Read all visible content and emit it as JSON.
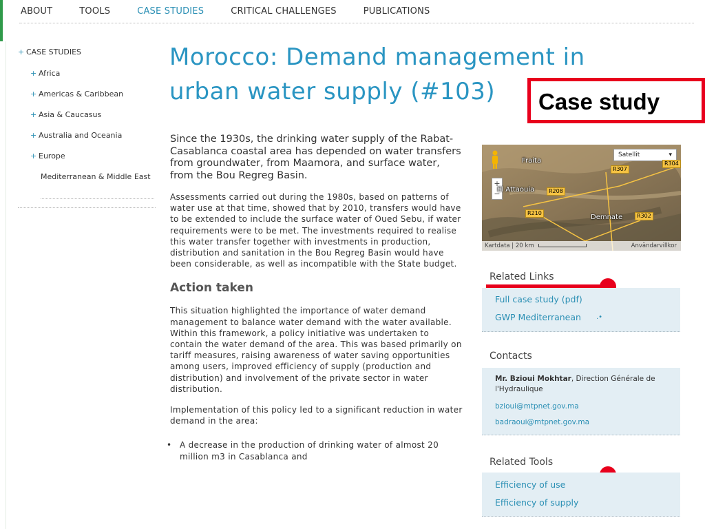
{
  "nav": {
    "items": [
      {
        "label": "ABOUT",
        "active": false
      },
      {
        "label": "TOOLS",
        "active": false
      },
      {
        "label": "CASE STUDIES",
        "active": true
      },
      {
        "label": "CRITICAL CHALLENGES",
        "active": false
      },
      {
        "label": "PUBLICATIONS",
        "active": false
      }
    ]
  },
  "sidebar": {
    "root": {
      "plus": "+",
      "label": "CASE STUDIES"
    },
    "items": [
      {
        "plus": "+",
        "label": "Africa"
      },
      {
        "plus": "+",
        "label": "Americas & Caribbean"
      },
      {
        "plus": "+",
        "label": "Asia & Caucasus"
      },
      {
        "plus": "+",
        "label": "Australia and Oceania"
      },
      {
        "plus": "+",
        "label": "Europe"
      }
    ],
    "current": "Mediterranean & Middle East"
  },
  "page": {
    "title": "Morocco: Demand management in urban water supply (#103)"
  },
  "annotation": {
    "label": "Case study",
    "color": "#e8001c"
  },
  "content": {
    "lead": "Since the 1930s, the drinking water supply of the Rabat-Casablanca coastal area has depended on water transfers from groundwater, from Maamora, and surface water, from the Bou Regreg Basin.",
    "para1": "Assessments carried out during the 1980s, based on patterns of water use at that time, showed that by 2010, transfers would have to be extended to include the surface water of Oued Sebu, if water requirements were to be met. The investments required to realise this water transfer together with investments in production, distribution and sanitation in the Bou Regreg Basin would have been considerable, as well as incompatible with the State budget.",
    "heading": "Action taken",
    "para2": "This situation highlighted the importance of water demand management to balance water demand with the water available. Within this framework, a policy initiative was undertaken to contain the water demand of the area. This was based primarily on tariff measures, raising awareness of water saving opportunities among users, improved efficiency of supply (production and distribution) and involvement of the private sector in water distribution.",
    "para3": "Implementation of this policy led to a significant reduction in water demand in the area:",
    "bullet1": "A decrease in the production of drinking water of almost 20 million m3 in Casablanca and"
  },
  "map": {
    "type_button": "Satellit",
    "footer": "Kartdata | 20 km",
    "terms": "Användarvillkor",
    "places": [
      "Fraita",
      "El Attaouia",
      "Demnate"
    ],
    "roads": [
      "R307",
      "R304",
      "R208",
      "R210",
      "R302"
    ]
  },
  "related_links": {
    "title": "Related Links",
    "items": [
      "Full case study (pdf)",
      "GWP Mediterranean"
    ]
  },
  "contacts": {
    "title": "Contacts",
    "name": "Mr. Bzioui Mokhtar",
    "role": ", Direction Générale de l'Hydraulique",
    "emails": [
      "bzioui@mtpnet.gov.ma",
      "badraoui@mtpnet.gov.ma"
    ]
  },
  "related_tools": {
    "title": "Related Tools",
    "items": [
      "Efficiency of use",
      "Efficiency of supply"
    ]
  },
  "colors": {
    "accent": "#2a95c2",
    "link": "#2a8fb4",
    "panel": "#e3eef4",
    "annotation_red": "#e8001c"
  }
}
